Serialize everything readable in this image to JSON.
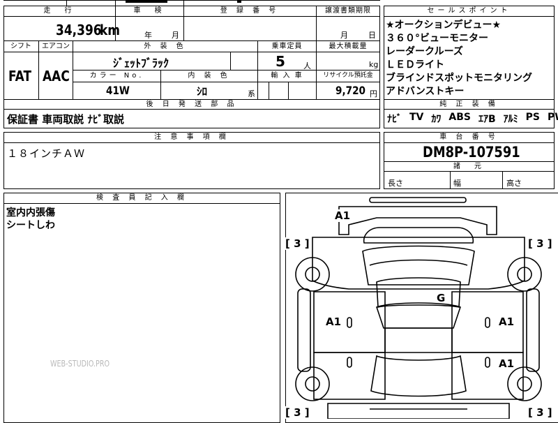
{
  "header": {
    "mileage_label": "走　行",
    "inspection_label": "車　検",
    "registration_label": "登 録 番 号",
    "transfer_deadline_label": "譲渡書類期限",
    "sales_point_label": "セールスポイント"
  },
  "mileage": {
    "value": "34,396",
    "unit": "km"
  },
  "inspection": {
    "year_unit": "年",
    "month_unit": "月"
  },
  "transfer": {
    "month_unit": "月",
    "day_unit": "日"
  },
  "labels": {
    "shift": "シフト",
    "aircon": "エアコン",
    "exterior_color": "外 装 色",
    "capacity": "乗車定員",
    "max_load": "最大積載量",
    "color_no": "カラー No.",
    "interior_color": "内 装 色",
    "import": "輸 入 車",
    "recycle_fee": "リサイクル預託金",
    "after_parts": "後 日 発 送 部 品",
    "notes": "注 意 事 項 欄",
    "chassis_no": "車 台 番 号",
    "specs": "諸　元",
    "inspector_notes": "検 査 員 記 入 欄",
    "genuine_equipment": "純 正 装 備"
  },
  "vehicle": {
    "shift": "FAT",
    "aircon": "AAC",
    "exterior_color": "ｼﾞｪｯﾄﾌﾞﾗｯｸ",
    "capacity_value": "5",
    "capacity_unit": "人",
    "max_load_unit": "kg",
    "color_no": "41W",
    "interior_color": "ｼﾛ",
    "interior_suffix": "系",
    "recycle_fee_value": "9,720",
    "recycle_fee_unit": "円",
    "chassis_no": "DM8P-107591"
  },
  "sales_points": [
    "★オークションデビュー★",
    "３６０°ビューモニター",
    "レーダークルーズ",
    "ＬＥＤライト",
    "ブラインドスポットモニタリング",
    "アドバンストキー"
  ],
  "equipment": [
    "ﾅﾋﾞ",
    "TV",
    "ｶﾜ",
    "ABS",
    "ｴｱB",
    "ｱﾙﾐ",
    "PS",
    "PW"
  ],
  "after_parts": "保証書 車両取説 ﾅﾋﾞ取説",
  "notes": "１８インチＡＷ",
  "specs": {
    "length": "長さ",
    "width": "幅",
    "height": "高さ"
  },
  "inspector_notes": [
    "室内内張傷",
    "シートしわ"
  ],
  "diagram_marks": {
    "roof": "A1",
    "center": "G",
    "left_front_door": "A1",
    "right_front_door": "A1",
    "right_rear_door": "A1",
    "tire_fl": "[ 3 ]",
    "tire_fr": "[ 3 ]",
    "tire_rl": "[ 3 ]",
    "tire_rr": "[ 3 ]"
  },
  "watermark": "WEB-STUDIO.PRO"
}
